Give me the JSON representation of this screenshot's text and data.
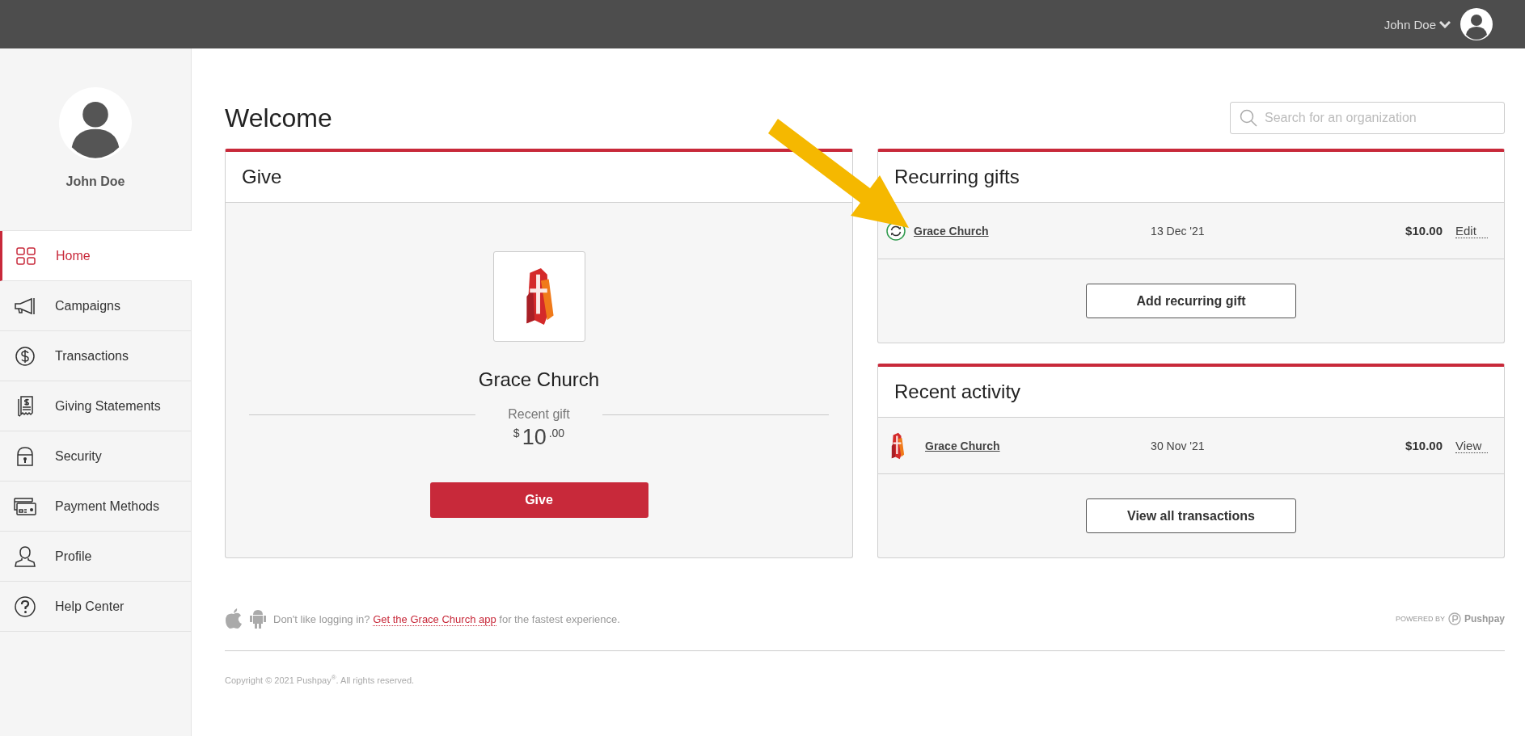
{
  "topbar": {
    "user_name": "John Doe"
  },
  "sidebar": {
    "user_name": "John Doe",
    "items": [
      {
        "label": "Home",
        "selected": true
      },
      {
        "label": "Campaigns",
        "selected": false
      },
      {
        "label": "Transactions",
        "selected": false
      },
      {
        "label": "Giving Statements",
        "selected": false
      },
      {
        "label": "Security",
        "selected": false
      },
      {
        "label": "Payment Methods",
        "selected": false
      },
      {
        "label": "Profile",
        "selected": false
      },
      {
        "label": "Help Center",
        "selected": false
      }
    ]
  },
  "page": {
    "title": "Welcome",
    "search": {
      "placeholder": "Search for an organization"
    }
  },
  "give_card": {
    "title": "Give",
    "organization": "Grace Church",
    "recent_label": "Recent gift",
    "currency": "$",
    "amount_whole": "10",
    "amount_cents": ".00",
    "button": "Give"
  },
  "recurring_gifts": {
    "title": "Recurring gifts",
    "rows": [
      {
        "name": "Grace Church",
        "date": "13 Dec '21",
        "amount": "$10.00",
        "action": "Edit"
      }
    ],
    "button": "Add recurring gift"
  },
  "recent_activity": {
    "title": "Recent activity",
    "rows": [
      {
        "name": "Grace Church",
        "date": "30 Nov '21",
        "amount": "$10.00",
        "action": "View"
      }
    ],
    "button": "View all transactions"
  },
  "footer": {
    "prompt_before": "Don't like logging in?",
    "prompt_link": "Get the Grace Church app",
    "prompt_after": "for the fastest experience.",
    "powered_by": "POWERED BY",
    "brand": "Pushpay",
    "copyright": "Copyright © 2021 Pushpay$^{®}$. All rights reserved."
  }
}
